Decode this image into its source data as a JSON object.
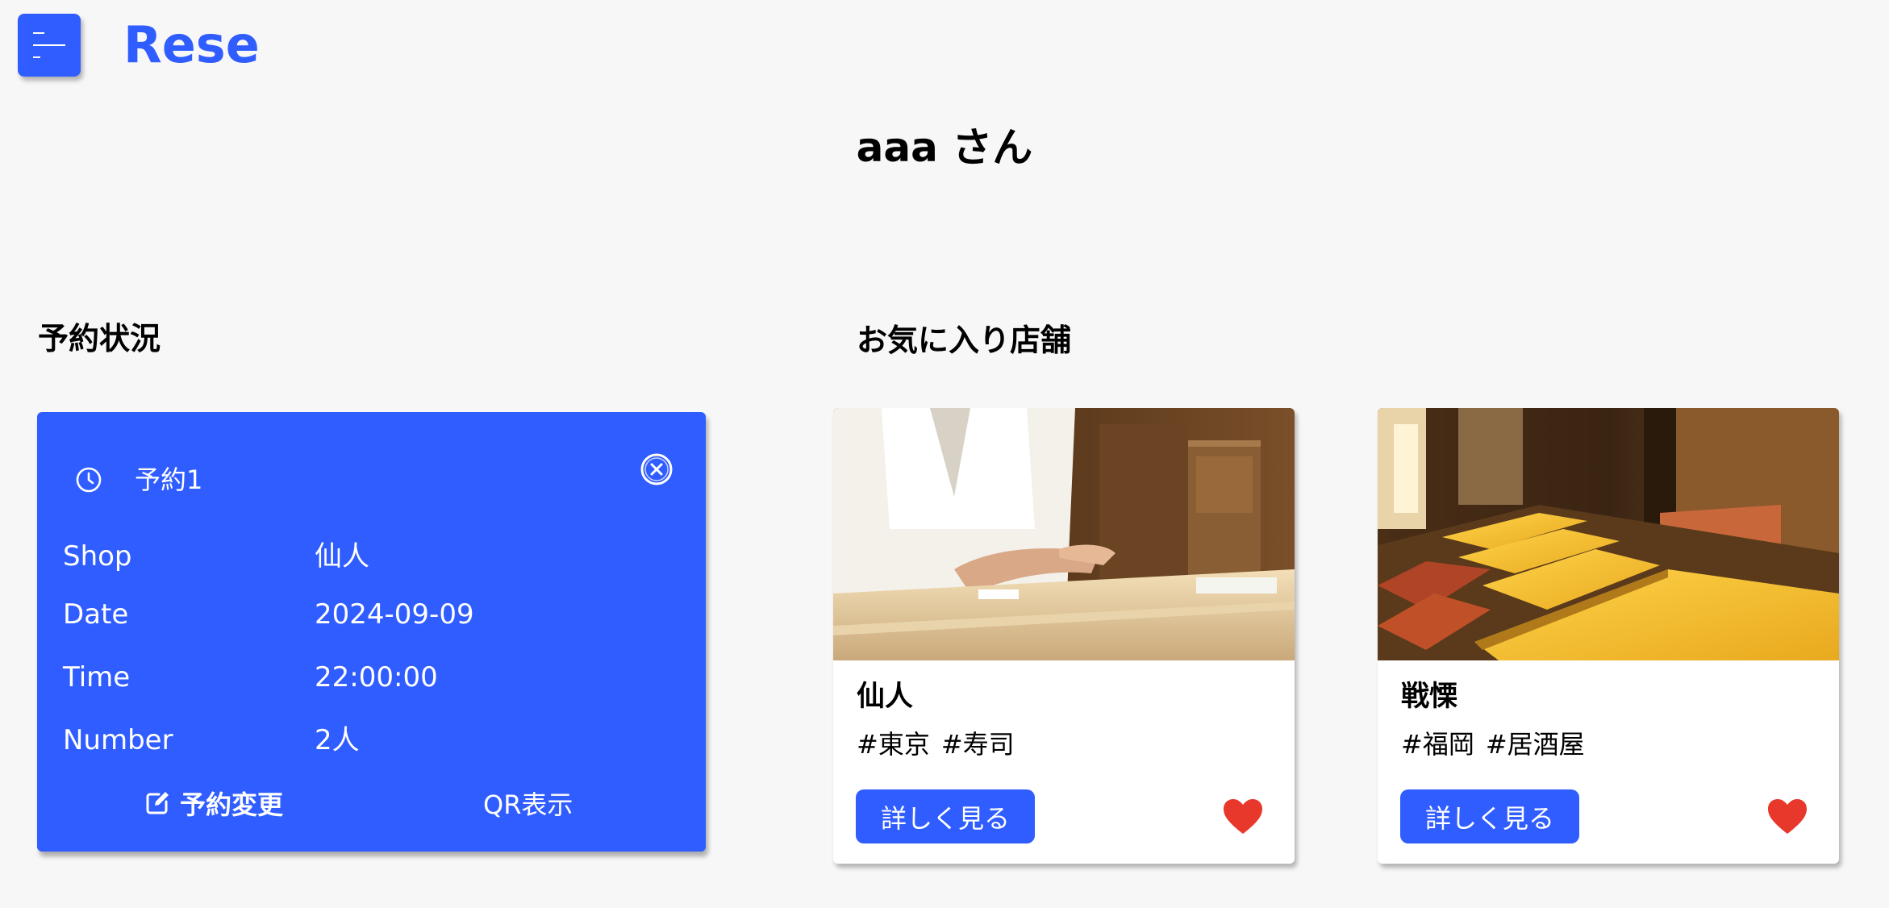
{
  "header": {
    "logo": "Rese",
    "menu_icon": "hamburger-menu-icon",
    "brand_color": "#305dff"
  },
  "user": {
    "greeting": "aaa さん"
  },
  "reservations": {
    "section_title": "予約状況",
    "items": [
      {
        "title": "予約1",
        "icon": "clock-icon",
        "close_icon": "close-circle-icon",
        "rows": [
          {
            "label": "Shop",
            "value": "仙人"
          },
          {
            "label": "Date",
            "value": "2024-09-09"
          },
          {
            "label": "Time",
            "value": "22:00:00"
          },
          {
            "label": "Number",
            "value": "2人"
          }
        ],
        "edit_label": "予約変更",
        "edit_icon": "edit-icon",
        "qr_label": "QR表示"
      }
    ]
  },
  "favorites": {
    "section_title": "お気に入り店舗",
    "shops": [
      {
        "name": "仙人",
        "tags": [
          "#東京",
          "#寿司"
        ],
        "button_label": "詳しく見る",
        "heart_color": "#e8382b",
        "image": "sushi-chef-photo"
      },
      {
        "name": "戦慄",
        "tags": [
          "#福岡",
          "#居酒屋"
        ],
        "button_label": "詳しく見る",
        "heart_color": "#e8382b",
        "image": "izakaya-interior-photo"
      }
    ]
  }
}
